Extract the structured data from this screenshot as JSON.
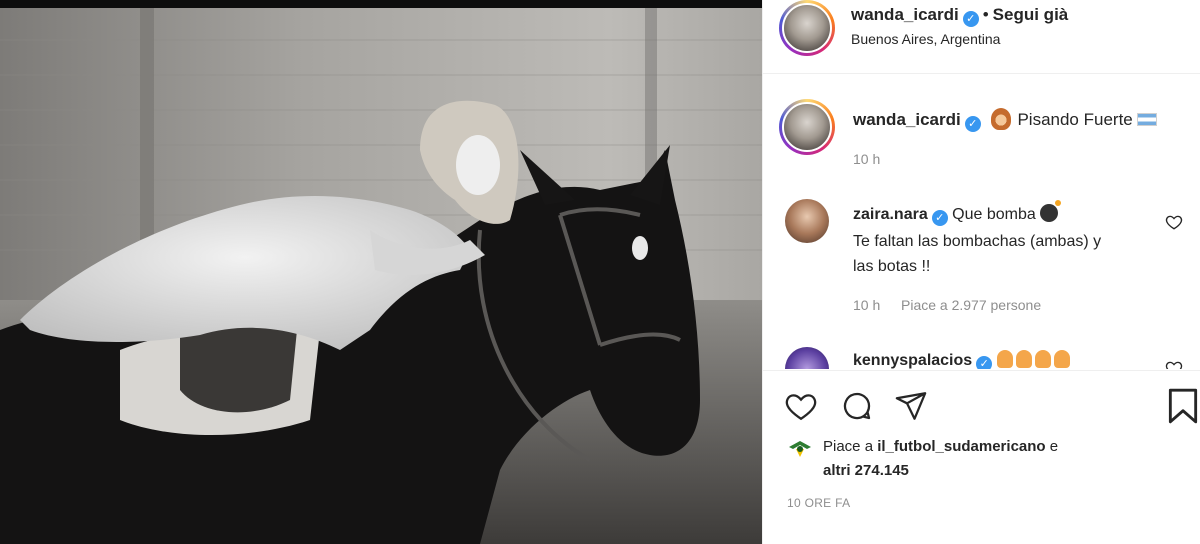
{
  "post": {
    "author": "wanda_icardi",
    "follow_status": "Segui già",
    "separator": "•",
    "location": "Buenos Aires, Argentina",
    "caption": "Pisando Fuerte",
    "caption_time": "10 h"
  },
  "comments": [
    {
      "username": "zaira.nara",
      "text": "Que bomba",
      "text_line2": "Te faltan las bombachas (ambas) y",
      "text_line3": "las botas !!",
      "time": "10 h",
      "likes": "Piace a 2.977 persone"
    },
    {
      "username": "kennyspalacios"
    }
  ],
  "actions": {
    "likes_prefix": "Piace a ",
    "likes_user": "il_futbol_sudamericano",
    "likes_suffix": " e",
    "likes_line2": "altri 274.145",
    "time_ago": "10 ORE FA"
  },
  "colors": {
    "verified": "#3897f0",
    "meta_text": "#8e8e8e",
    "primary_text": "#262626"
  },
  "icons": [
    "verified-badge",
    "heart-icon",
    "comment-icon",
    "share-icon",
    "bookmark-icon",
    "argentina-flag-icon",
    "bomb-emoji",
    "hand-emoji"
  ]
}
